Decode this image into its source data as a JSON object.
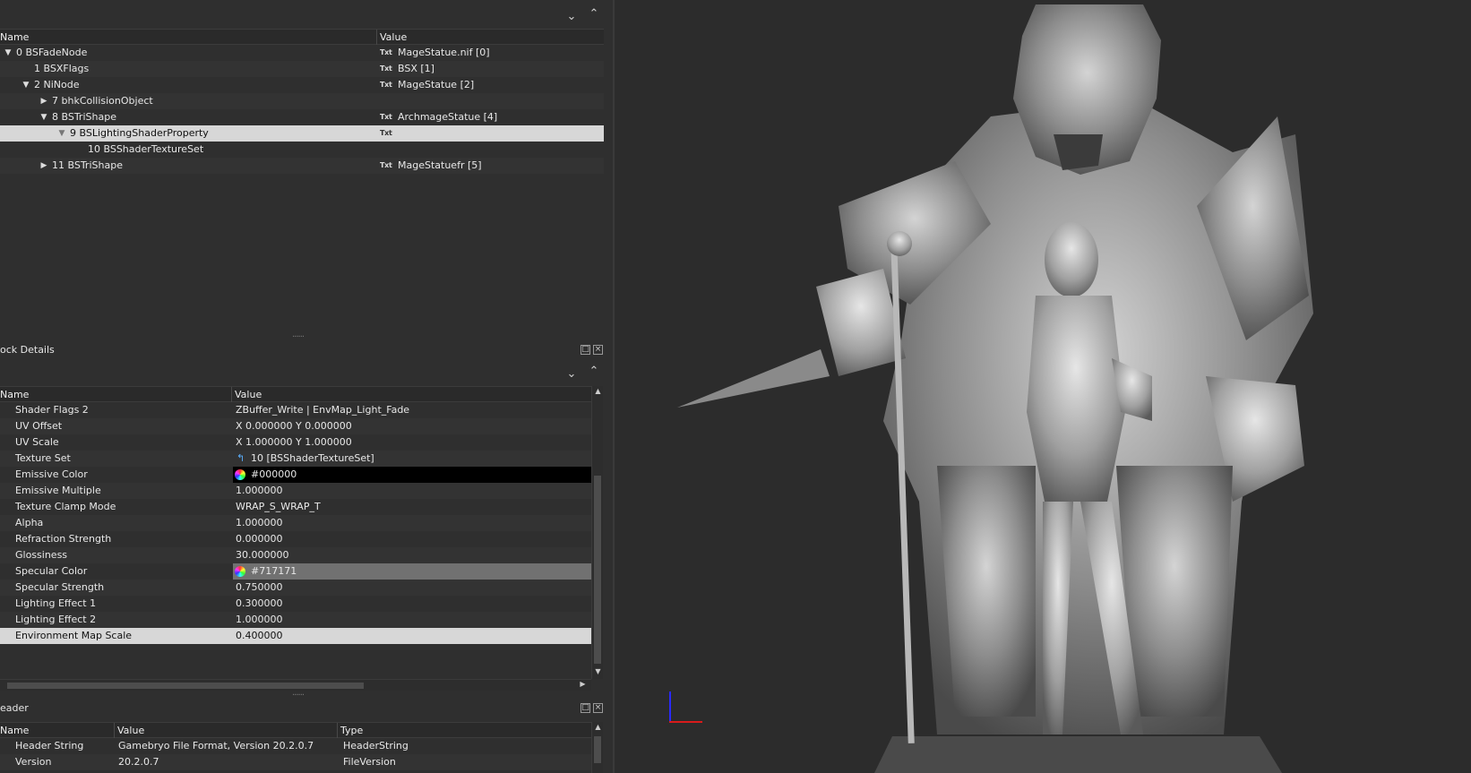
{
  "nif_list": {
    "columns": [
      "Name",
      "Value"
    ],
    "rows": [
      {
        "indent": 0,
        "arrow": "down",
        "name": "0 BSFadeNode",
        "txt": "Txt",
        "value": "MageStatue.nif [0]"
      },
      {
        "indent": 1,
        "arrow": "none",
        "name": "1 BSXFlags",
        "txt": "Txt",
        "value": "BSX [1]"
      },
      {
        "indent": 1,
        "arrow": "down",
        "name": "2 NiNode",
        "txt": "Txt",
        "value": "MageStatue [2]"
      },
      {
        "indent": 2,
        "arrow": "right",
        "name": "7 bhkCollisionObject",
        "txt": "",
        "value": ""
      },
      {
        "indent": 2,
        "arrow": "down",
        "name": "8 BSTriShape",
        "txt": "Txt",
        "value": "ArchmageStatue [4]"
      },
      {
        "indent": 3,
        "arrow": "down",
        "name": "9 BSLightingShaderProperty",
        "txt": "Txt",
        "value": ""
      },
      {
        "indent": 4,
        "arrow": "none",
        "name": "10 BSShaderTextureSet",
        "txt": "",
        "value": ""
      },
      {
        "indent": 2,
        "arrow": "right",
        "name": "11 BSTriShape",
        "txt": "Txt",
        "value": "MageStatuefr [5]"
      }
    ],
    "grip": "......"
  },
  "block_details": {
    "title": "ock Details",
    "columns": [
      "Name",
      "Value"
    ],
    "rows": [
      {
        "name": "Shader Flags 2",
        "value": "ZBuffer_Write | EnvMap_Light_Fade"
      },
      {
        "name": "UV Offset",
        "value": "X 0.000000 Y 0.000000"
      },
      {
        "name": "UV Scale",
        "value": "X 1.000000 Y 1.000000"
      },
      {
        "name": "Texture Set",
        "value": "10 [BSShaderTextureSet]",
        "icon": "link-icon"
      },
      {
        "name": "Emissive Color",
        "value": "#000000",
        "swatch": "#000000"
      },
      {
        "name": "Emissive Multiple",
        "value": "1.000000"
      },
      {
        "name": "Texture Clamp Mode",
        "value": "WRAP_S_WRAP_T"
      },
      {
        "name": "Alpha",
        "value": "1.000000"
      },
      {
        "name": "Refraction Strength",
        "value": "0.000000"
      },
      {
        "name": "Glossiness",
        "value": "30.000000"
      },
      {
        "name": "Specular Color",
        "value": "#717171",
        "swatch": "#717171"
      },
      {
        "name": "Specular Strength",
        "value": "0.750000"
      },
      {
        "name": "Lighting Effect 1",
        "value": "0.300000"
      },
      {
        "name": "Lighting Effect 2",
        "value": "1.000000"
      },
      {
        "name": "Environment Map Scale",
        "value": "0.400000"
      }
    ],
    "grip": "......"
  },
  "header_panel": {
    "title": "eader",
    "columns": [
      "Name",
      "Value",
      "Type"
    ],
    "rows": [
      {
        "name": "Header String",
        "value": "Gamebryo File Format, Version 20.2.0.7",
        "type": "HeaderString"
      },
      {
        "name": "Version",
        "value": "20.2.0.7",
        "type": "FileVersion"
      }
    ]
  },
  "colors": {
    "selection": "#d7d7d7",
    "axis_x": "#d81b1b",
    "axis_y": "#2a2aff"
  }
}
